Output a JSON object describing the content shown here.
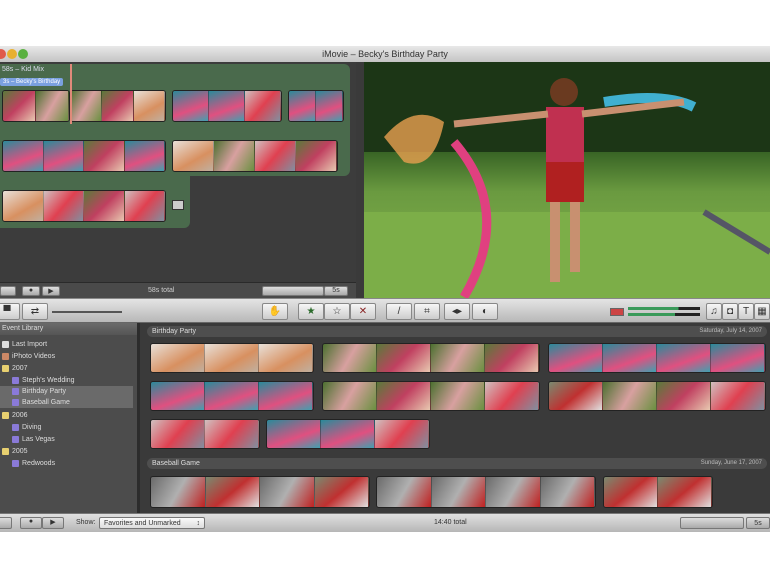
{
  "window": {
    "title": "iMovie – Becky's Birthday Party"
  },
  "project": {
    "title": "58s – Kid Mix",
    "tag": "3s – Becky's Birthday",
    "total": "58s total",
    "zoom_label": "5s"
  },
  "toolbar": {
    "buttons": [
      "add-to-project",
      "favorite",
      "unmark",
      "reject",
      "voiceover",
      "crop",
      "audio-adjust",
      "video-adjust"
    ],
    "right_buttons": [
      "music",
      "photos",
      "titles",
      "transitions"
    ]
  },
  "library": {
    "title": "Event Library",
    "items": [
      {
        "label": "Last Import",
        "type": "import"
      },
      {
        "label": "iPhoto Videos",
        "type": "iphoto"
      },
      {
        "label": "2007",
        "type": "folder"
      },
      {
        "label": "Steph's Wedding",
        "type": "event"
      },
      {
        "label": "Birthday Party",
        "type": "event",
        "selected": true
      },
      {
        "label": "Baseball Game",
        "type": "event",
        "selected": true
      },
      {
        "label": "2006",
        "type": "folder"
      },
      {
        "label": "Diving",
        "type": "event"
      },
      {
        "label": "Las Vegas",
        "type": "event"
      },
      {
        "label": "2005",
        "type": "folder"
      },
      {
        "label": "Redwoods",
        "type": "event"
      }
    ]
  },
  "events": [
    {
      "name": "Birthday Party",
      "date": "Saturday, July 14, 2007"
    },
    {
      "name": "Baseball Game",
      "date": "Sunday, June 17, 2007"
    }
  ],
  "bottom": {
    "show_label": "Show:",
    "show_value": "Favorites and Unmarked",
    "total": "14:40 total",
    "zoom_label": "5s"
  },
  "colors": {
    "project_bg": "#4a6a4c",
    "accent_selected": "#7aa0e0"
  }
}
